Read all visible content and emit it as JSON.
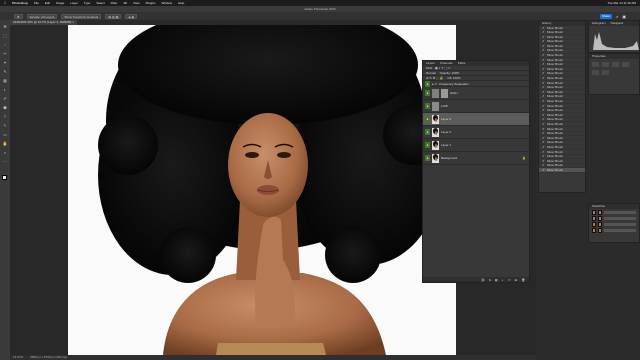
{
  "os_menu": {
    "apple": "",
    "app": "Photoshop",
    "items": [
      "File",
      "Edit",
      "Image",
      "Layer",
      "Type",
      "Select",
      "Filter",
      "3D",
      "View",
      "Plugins",
      "Window",
      "Help"
    ],
    "clock": "Tue Mar 14 11:16 AM"
  },
  "window_title": "Adobe Photoshop 2023",
  "options_bar": {
    "sample": "Sample: All Layers",
    "show": "Show Transform Controls",
    "share": "Share"
  },
  "document_tab": {
    "name": "AFRO003.JPG @ 16.7% (Layer 3, RGB/8#)"
  },
  "status_bar": {
    "zoom": "16.67%",
    "info": "3840 px x 5760 px (300 ppi)"
  },
  "history": {
    "title": "History",
    "item": "Mixer Brush",
    "count": 32,
    "selected_index": 31
  },
  "histogram": {
    "title": "Histogram",
    "tab2": "Navigator"
  },
  "properties": {
    "title": "Properties"
  },
  "layers": {
    "tabs": [
      "Layers",
      "Channels",
      "Paths"
    ],
    "kind": "Kind",
    "blend": "Normal",
    "opacity": "Opacity: 100%",
    "fill": "Fill: 100%",
    "rows": [
      {
        "name": "Frequency Separation",
        "type": "group"
      },
      {
        "name": "HIGH",
        "type": "mask"
      },
      {
        "name": "LOW",
        "type": "plain"
      },
      {
        "name": "Layer 3",
        "type": "photo"
      },
      {
        "name": "Layer 2",
        "type": "photo"
      },
      {
        "name": "Layer 1",
        "type": "photo"
      },
      {
        "name": "Background",
        "type": "photo"
      }
    ]
  },
  "swatches": {
    "title": "Swatches",
    "rows": 4
  },
  "colors": {
    "accent": "#1473e6",
    "skin": "#b07855",
    "hair": "#0b0b0b",
    "eye_on": "#3f7a2a",
    "panel": "#383838"
  }
}
